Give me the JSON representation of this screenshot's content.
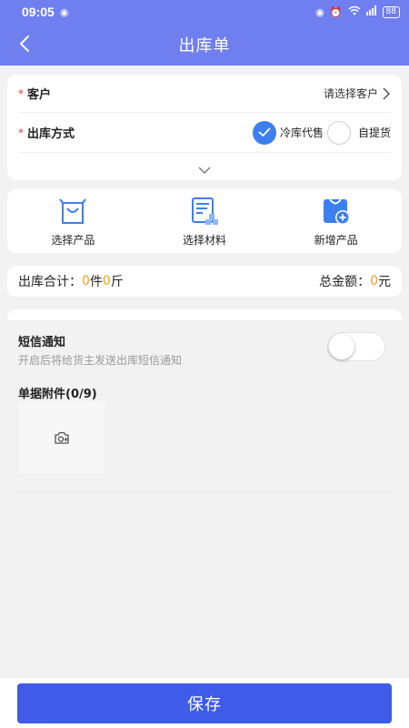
{
  "status_bar": {
    "time": "09:05",
    "battery": "88"
  },
  "header": {
    "title": "出库单"
  },
  "form": {
    "customer": {
      "required_mark": "*",
      "label": "客户",
      "placeholder": "请选择客户"
    },
    "delivery": {
      "required_mark": "*",
      "label": "出库方式",
      "options": [
        {
          "label": "冷库代售",
          "selected": true
        },
        {
          "label": "自提货",
          "selected": false
        }
      ]
    }
  },
  "tools": [
    {
      "label": "选择产品",
      "icon": "shopping-bag-icon"
    },
    {
      "label": "选择材料",
      "icon": "materials-icon"
    },
    {
      "label": "新增产品",
      "icon": "add-product-icon"
    }
  ],
  "summary": {
    "left_label": "出库合计：",
    "piece_count": "0",
    "piece_unit": "件",
    "weight": "0",
    "weight_unit": "斤",
    "right_label": "总金额：",
    "amount": "0",
    "amount_unit": "元"
  },
  "sms": {
    "title": "短信通知",
    "desc": "开启后将给货主发送出库短信通知",
    "enabled": false
  },
  "attachments": {
    "title": "单据附件(0/9)"
  },
  "footer": {
    "save_label": "保存"
  },
  "colors": {
    "header": "#6f7ff0",
    "accent": "#3d7ef0",
    "save_button": "#3e5bea",
    "amount": "#f0a020",
    "required": "#e23b3b"
  }
}
